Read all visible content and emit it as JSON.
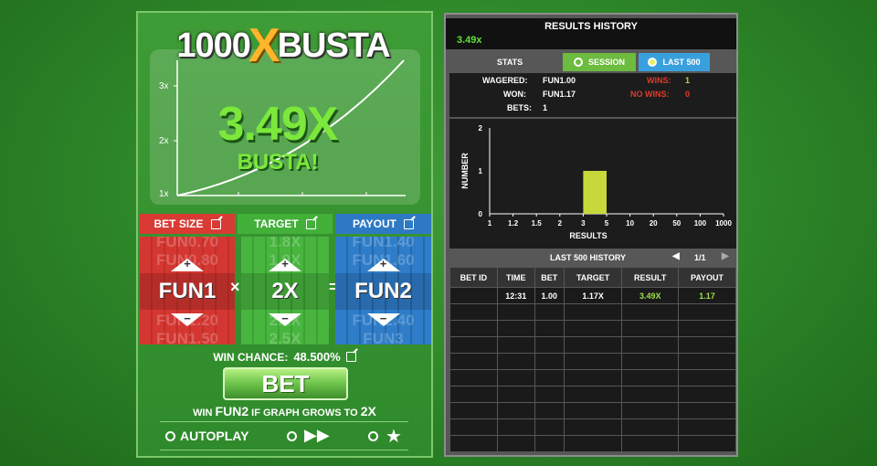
{
  "game": {
    "logo_left": "1000",
    "logo_x": "X",
    "logo_right": "BUSTA",
    "multiplier": "3.49X",
    "status": "BUSTA!",
    "y_ticks": [
      "3x",
      "2x",
      "1x"
    ],
    "controls": {
      "bet_size": {
        "header": "BET SIZE",
        "value": "FUN1",
        "above": [
          "FUN0.70",
          "FUN0.80"
        ],
        "below": [
          "FUN1.20",
          "FUN1.50"
        ]
      },
      "target": {
        "header": "TARGET",
        "value": "2X",
        "above": [
          "1.8X",
          "1.9X"
        ],
        "below": [
          "2.2X",
          "2.5X"
        ]
      },
      "payout": {
        "header": "PAYOUT",
        "value": "FUN2",
        "above": [
          "FUN1.40",
          "FUN1.60"
        ],
        "below": [
          "FUN2.40",
          "FUN3"
        ]
      },
      "op_multiply": "×",
      "op_equals": "="
    },
    "win_chance_label": "WIN CHANCE:",
    "win_chance_value": "48.500%",
    "bet_label": "BET",
    "win_line": {
      "p1": "WIN",
      "payout": "FUN2",
      "p2": "IF GRAPH GROWS TO",
      "target": "2X"
    },
    "autoplay_label": "AUTOPLAY"
  },
  "results": {
    "title": "RESULTS HISTORY",
    "last_result": "3.49x",
    "stats_label": "STATS",
    "tab_session": "SESSION",
    "tab_last500": "LAST 500",
    "wagered_label": "WAGERED:",
    "wagered_value": "FUN1.00",
    "won_label": "WON:",
    "won_value": "FUN1.17",
    "bets_label": "BETS:",
    "bets_value": "1",
    "wins_label": "WINS:",
    "wins_value": "1",
    "nowins_label": "NO WINS:",
    "nowins_value": "0",
    "history_label": "LAST 500 HISTORY",
    "page": "1/1",
    "columns": [
      "BET ID",
      "TIME",
      "BET",
      "TARGET",
      "RESULT",
      "PAYOUT"
    ],
    "rows": [
      [
        "",
        "12:31",
        "1.00",
        "1.17X",
        "3.49X",
        "1.17"
      ]
    ],
    "empty_rows": 9
  },
  "chart_data": {
    "type": "bar",
    "xlabel": "RESULTS",
    "ylabel": "NUMBER",
    "categories": [
      "1",
      "1.2",
      "1.5",
      "2",
      "3",
      "5",
      "10",
      "20",
      "50",
      "100",
      "1000"
    ],
    "bins": [
      {
        "from": "3",
        "to": "5",
        "value": 1
      }
    ],
    "ylim": [
      0,
      2
    ],
    "yticks": [
      "0",
      "1",
      "2"
    ],
    "bar_color": "#c7d93a"
  },
  "colors": {
    "bet_red": "#d93a34",
    "target_green": "#43b03a",
    "payout_blue": "#2e79c4",
    "accent_green": "#7be83b"
  }
}
